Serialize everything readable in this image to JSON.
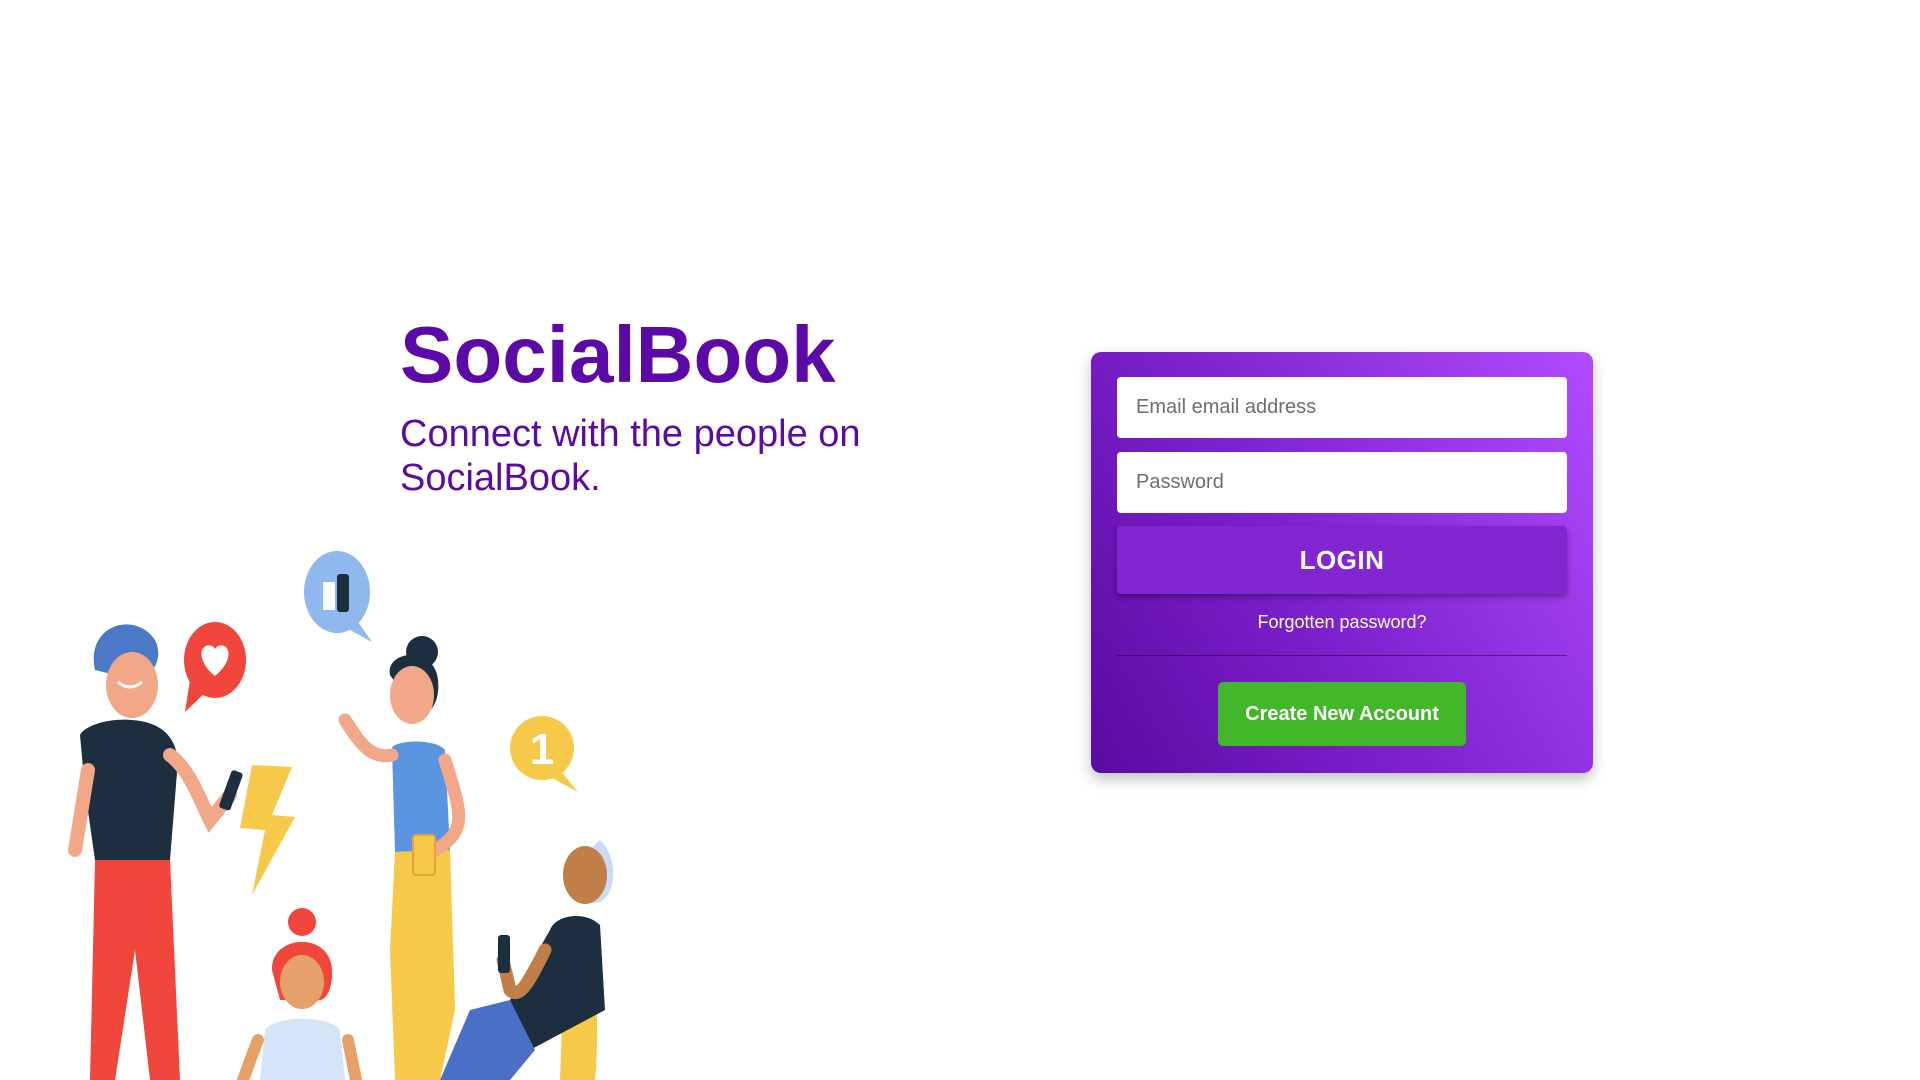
{
  "brand": {
    "title": "SocialBook",
    "tagline": "Connect with the people on SocialBook."
  },
  "login_form": {
    "email_placeholder": "Email email address",
    "password_placeholder": "Password",
    "login_label": "LOGIN",
    "forgot_label": "Forgotten password?",
    "create_label": "Create New Account"
  },
  "illustration": {
    "speech_badges": [
      "thumbs-up-icon",
      "heart-icon",
      "lightning-icon"
    ],
    "notification_count": "1"
  },
  "colors": {
    "brand": "#5b0aa8",
    "card_gradient_start": "#5a0aa0",
    "card_gradient_end": "#b14bff",
    "login_button": "#8226d2",
    "create_button": "#42b72a"
  }
}
